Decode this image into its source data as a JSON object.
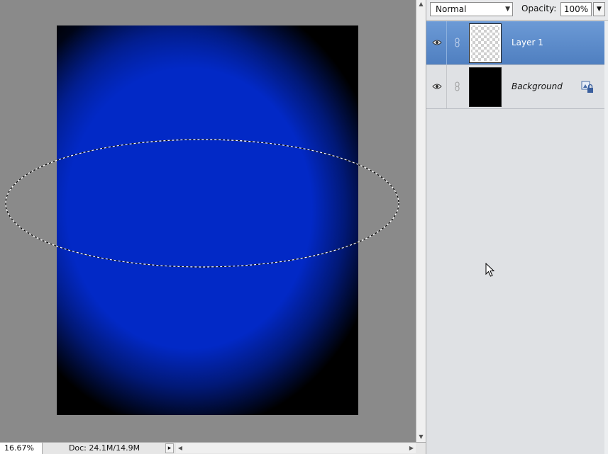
{
  "status": {
    "zoom": "16.67%",
    "doc_info": "Doc: 24.1M/14.9M"
  },
  "layers_panel": {
    "blend_mode": "Normal",
    "opacity_label": "Opacity:",
    "opacity_value": "100%",
    "layers": [
      {
        "name": "Layer 1",
        "selected": true,
        "thumbnail": "transparent-checkerboard"
      },
      {
        "name": "Background",
        "selected": false,
        "thumbnail": "black-fill",
        "locked": true
      }
    ]
  },
  "icons": {
    "visibility": "eye-icon",
    "link": "chain-link-icon",
    "lock": "lock-icon",
    "dropdown": "chevron-down-icon"
  },
  "colors": {
    "canvas_fill": "#0229c6",
    "document_base": "#000000",
    "workspace": "#8a8a8a",
    "selected_layer": "#5b8bcb"
  }
}
